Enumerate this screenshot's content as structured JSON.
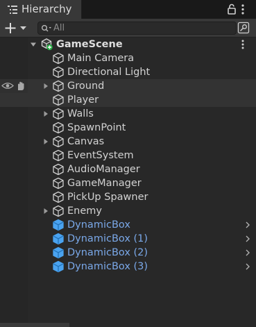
{
  "panel": {
    "tab_title": "Hierarchy"
  },
  "toolbar": {
    "create_label": "+",
    "search_placeholder": "All"
  },
  "scene": {
    "name": "GameScene"
  },
  "items": [
    {
      "label": "Main Camera",
      "expandable": false,
      "prefab": false
    },
    {
      "label": "Directional Light",
      "expandable": false,
      "prefab": false
    },
    {
      "label": "Ground",
      "expandable": true,
      "prefab": false
    },
    {
      "label": "Player",
      "expandable": false,
      "prefab": false
    },
    {
      "label": "Walls",
      "expandable": true,
      "prefab": false
    },
    {
      "label": "SpawnPoint",
      "expandable": false,
      "prefab": false
    },
    {
      "label": "Canvas",
      "expandable": true,
      "prefab": false
    },
    {
      "label": "EventSystem",
      "expandable": false,
      "prefab": false
    },
    {
      "label": "AudioManager",
      "expandable": false,
      "prefab": false
    },
    {
      "label": "GameManager",
      "expandable": false,
      "prefab": false
    },
    {
      "label": "PickUp Spawner",
      "expandable": false,
      "prefab": false
    },
    {
      "label": "Enemy",
      "expandable": true,
      "prefab": false
    },
    {
      "label": "DynamicBox",
      "expandable": false,
      "prefab": true
    },
    {
      "label": "DynamicBox (1)",
      "expandable": false,
      "prefab": true
    },
    {
      "label": "DynamicBox (2)",
      "expandable": false,
      "prefab": true
    },
    {
      "label": "DynamicBox (3)",
      "expandable": false,
      "prefab": true
    }
  ],
  "colors": {
    "prefab_text": "#7aa8e8",
    "prefab_icon": "#4aa3f0",
    "panel_bg": "#282828"
  }
}
